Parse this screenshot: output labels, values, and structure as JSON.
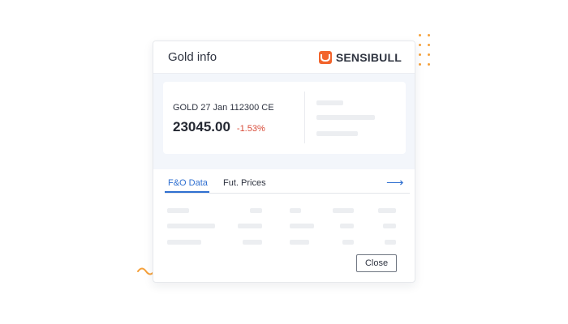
{
  "card": {
    "title": "Gold info",
    "brand": {
      "logo_icon": "sensibull-logo-icon",
      "name": "SENSIBULL",
      "color": "#f2642c"
    }
  },
  "quote": {
    "symbol": "GOLD 27 Jan 112300 CE",
    "price": "23045.00",
    "change": "-1.53%",
    "change_color": "#d84a37"
  },
  "tabs": {
    "items": [
      {
        "label": "F&O Data",
        "active": true
      },
      {
        "label": "Fut. Prices",
        "active": false
      }
    ],
    "next_icon": "arrow-right-icon",
    "accent": "#2f6fd0"
  },
  "footer": {
    "close_label": "Close"
  },
  "decorations": {
    "accent": "#f5a13c"
  }
}
